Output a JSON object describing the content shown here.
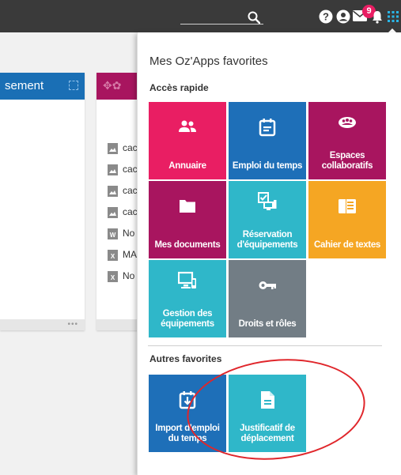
{
  "topbar": {
    "badge_count": "9",
    "icons": [
      "search-icon",
      "help-icon",
      "user-icon",
      "mail-icon",
      "bell-icon",
      "apps-grid-icon"
    ]
  },
  "background": {
    "panel1_title": "sement",
    "files": [
      "cac",
      "cac",
      "cac",
      "cac",
      "No",
      "MA",
      "No"
    ]
  },
  "dropdown": {
    "title": "Mes Oz'Apps favorites",
    "quick_access_title": "Accès rapide",
    "other_favorites_title": "Autres favorites",
    "quick_tiles": [
      {
        "label": "Annuaire",
        "color": "#e91e63",
        "icon": "people-icon"
      },
      {
        "label": "Emploi du temps",
        "color": "#1e6fb8",
        "icon": "calendar-icon"
      },
      {
        "label": "Espaces collaboratifs",
        "color": "#a8155f",
        "icon": "group-icon"
      },
      {
        "label": "Mes documents",
        "color": "#a8155f",
        "icon": "folder-icon"
      },
      {
        "label": "Réservation d'équipements",
        "color": "#2fb7c9",
        "icon": "equipment-booking-icon"
      },
      {
        "label": "Cahier de textes",
        "color": "#f5a623",
        "icon": "notebook-icon"
      },
      {
        "label": "Gestion des équipements",
        "color": "#2fb7c9",
        "icon": "devices-icon"
      },
      {
        "label": "Droits et rôles",
        "color": "#727d85",
        "icon": "key-icon"
      }
    ],
    "other_tiles": [
      {
        "label": "Import d'emploi du temps",
        "color": "#1e6fb8",
        "icon": "calendar-import-icon"
      },
      {
        "label": "Justificatif de déplacement",
        "color": "#2fb7c9",
        "icon": "document-icon"
      }
    ]
  }
}
